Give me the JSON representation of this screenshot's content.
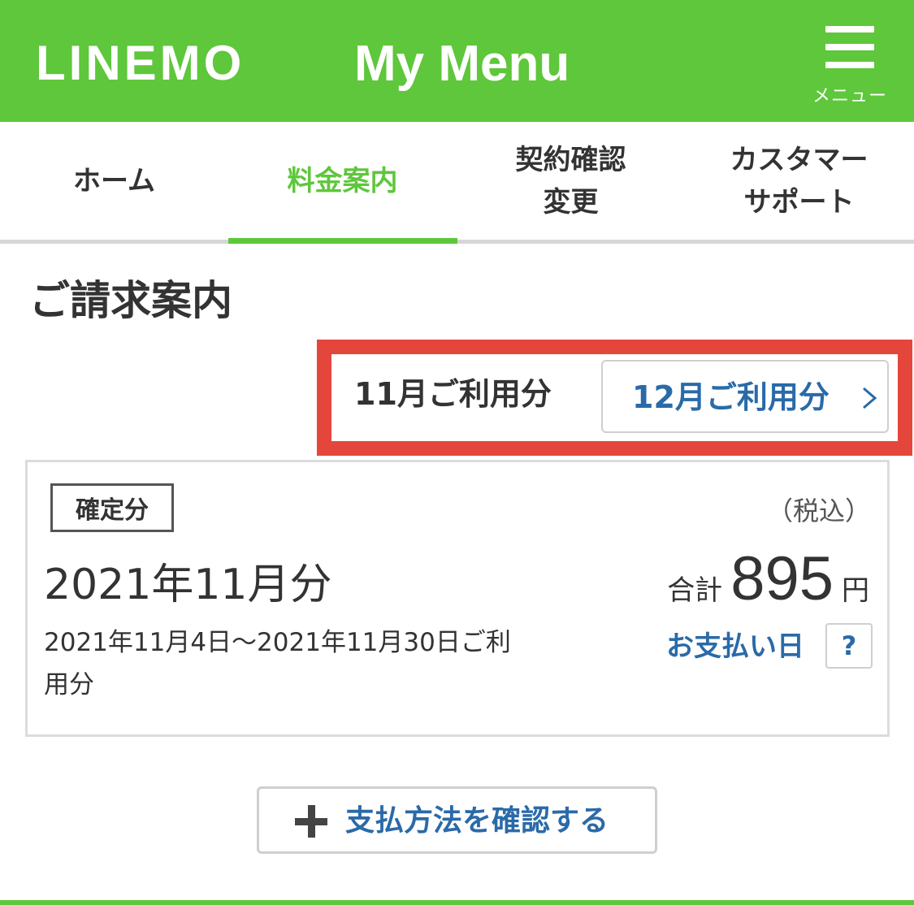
{
  "header": {
    "brand": "LINEMO",
    "title": "My Menu",
    "menu_label": "メニュー",
    "bg_color": "#5ec73b"
  },
  "tabs": [
    {
      "label": "ホーム",
      "active": false
    },
    {
      "label": "料金案内",
      "active": true
    },
    {
      "label": "契約確認\n変更",
      "active": false
    },
    {
      "label": "カスタマー\nサポート",
      "active": false
    }
  ],
  "section": {
    "title": "ご請求案内"
  },
  "month_selector": {
    "current": "11月ご利用分",
    "next": "12月ご利用分",
    "highlight_color": "#e5463c"
  },
  "bill": {
    "status": "確定分",
    "month": "2021年11月分",
    "period": "2021年11月4日～2021年11月30日ご利用分",
    "tax_note": "（税込）",
    "total_label": "合計",
    "total_amount": "895",
    "currency": "円",
    "pay_date_link": "お支払い日",
    "help": "?"
  },
  "payment_method": {
    "label": "支払方法を確認する"
  },
  "colors": {
    "accent_green": "#5ec73b",
    "link_blue": "#2a6aa8"
  },
  "icons": {
    "menu": "hamburger-icon",
    "next": "chevron-right-icon",
    "add": "plus-icon"
  }
}
